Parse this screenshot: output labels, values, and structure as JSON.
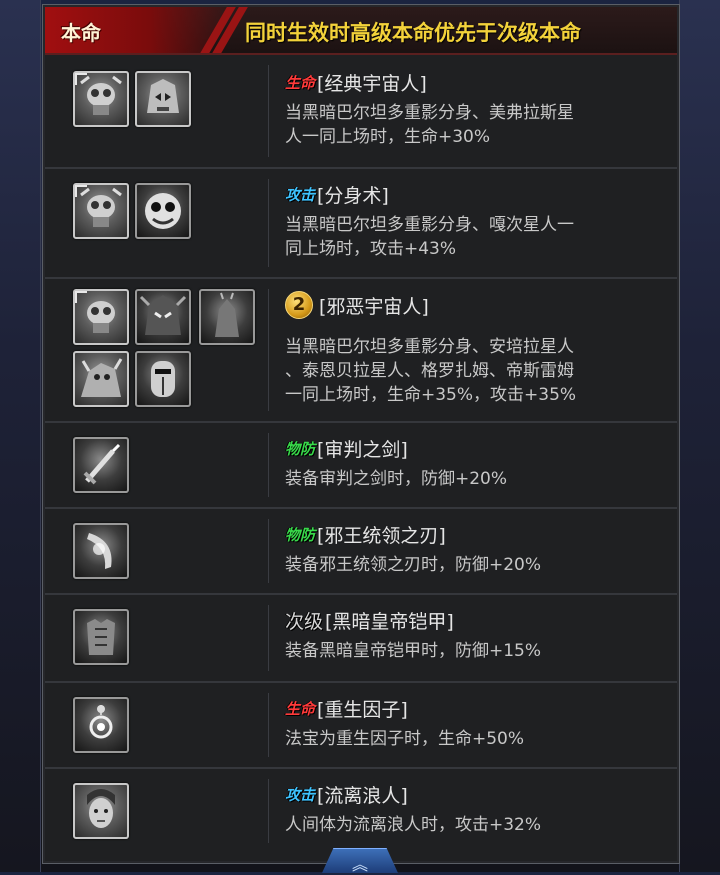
{
  "header": {
    "tag": "本命",
    "note": "同时生效时高级本命优先于次级本命"
  },
  "rows": [
    {
      "badge": "生命",
      "title": "[经典宇宙人]",
      "desc": [
        "当黑暗巴尔坦多重影分身、美弗拉斯星",
        "人一同上场时，生命+30%"
      ]
    },
    {
      "badge": "攻击",
      "title": "[分身术]",
      "desc": [
        "当黑暗巴尔坦多重影分身、嘎次星人一",
        "同上场时，攻击+43%"
      ]
    },
    {
      "badge": "2",
      "title": "[邪恶宇宙人]",
      "desc": [
        "当黑暗巴尔坦多重影分身、安培拉星人",
        "、泰恩贝拉星人、格罗扎姆、帝斯雷姆",
        "一同上场时，生命+35%，攻击+35%"
      ]
    },
    {
      "badge": "物防",
      "title": "[审判之剑]",
      "desc": [
        "装备审判之剑时，防御+20%"
      ]
    },
    {
      "badge": "物防",
      "title": "[邪王统领之刃]",
      "desc": [
        "装备邪王统领之刃时，防御+20%"
      ]
    },
    {
      "badge": "次级",
      "title": "[黑暗皇帝铠甲]",
      "desc": [
        "装备黑暗皇帝铠甲时，防御+15%"
      ]
    },
    {
      "badge": "生命",
      "title": "[重生因子]",
      "desc": [
        "法宝为重生因子时，生命+50%"
      ]
    },
    {
      "badge": "攻击",
      "title": "[流离浪人]",
      "desc": [
        "人间体为流离浪人时，攻击+32%"
      ]
    }
  ],
  "icons": {
    "row0": [
      "alien-mask-icon",
      "alien-mask-icon"
    ],
    "row1": [
      "alien-mask-icon",
      "creature-face-icon"
    ],
    "row2": [
      "alien-mask-icon",
      "dark-emperor-icon",
      "monster-icon",
      "kaiju-icon",
      "armored-knight-icon"
    ],
    "row3": [
      "sword-icon"
    ],
    "row4": [
      "blade-icon"
    ],
    "row5": [
      "armor-icon"
    ],
    "row6": [
      "orb-icon"
    ],
    "row7": [
      "human-face-icon"
    ]
  },
  "bottom_tab": "︽",
  "colors": {
    "hp": "#ff3a3a",
    "attack": "#3ec3ff",
    "defense": "#38d84a",
    "header_note": "#f3d23a",
    "header_tag_bg": "#a10f10"
  }
}
